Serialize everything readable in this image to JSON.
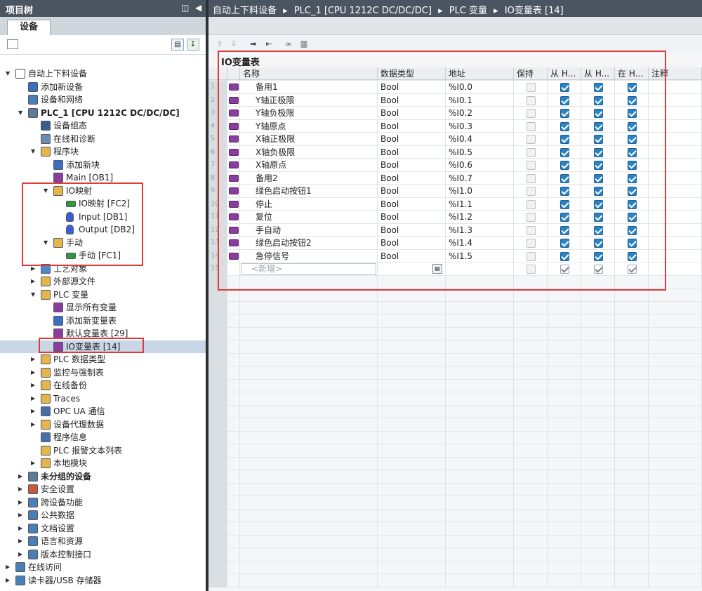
{
  "left": {
    "title": "项目树",
    "tab": "设备",
    "controls": [
      "◫",
      "◀"
    ]
  },
  "tree": [
    {
      "label": "自动上下料设备",
      "indent": 0,
      "arrow": "▼",
      "icon": "doc-icon",
      "color": "#ffffff"
    },
    {
      "label": "添加新设备",
      "indent": 1,
      "arrow": "",
      "icon": "add-device-icon",
      "color": "#3a6fc4"
    },
    {
      "label": "设备和网络",
      "indent": 1,
      "arrow": "",
      "icon": "network-icon",
      "color": "#4a7fb5"
    },
    {
      "label": "PLC_1 [CPU 1212C DC/DC/DC]",
      "indent": 1,
      "arrow": "▼",
      "icon": "plc-icon",
      "color": "#5f7c96",
      "bold": true
    },
    {
      "label": "设备组态",
      "indent": 2,
      "arrow": "",
      "icon": "config-icon",
      "color": "#3b5f8a"
    },
    {
      "label": "在线和诊断",
      "indent": 2,
      "arrow": "",
      "icon": "diagnostics-icon",
      "color": "#6c8bb0"
    },
    {
      "label": "程序块",
      "indent": 2,
      "arrow": "▼",
      "icon": "folder-icon",
      "color": "#e3b54a"
    },
    {
      "label": "添加新块",
      "indent": 3,
      "arrow": "",
      "icon": "add-block-icon",
      "color": "#3a6fc4"
    },
    {
      "label": "Main [OB1]",
      "indent": 3,
      "arrow": "",
      "icon": "ob-icon",
      "color": "#8a3d9e"
    },
    {
      "label": "IO映射",
      "indent": 3,
      "arrow": "▼",
      "icon": "folder-icon",
      "color": "#e3b54a"
    },
    {
      "label": "IO映射 [FC2]",
      "indent": 4,
      "arrow": "",
      "icon": "fc-icon",
      "color": "#2e9a3a"
    },
    {
      "label": "Input [DB1]",
      "indent": 4,
      "arrow": "",
      "icon": "db-icon",
      "color": "#3a5fd0"
    },
    {
      "label": "Output [DB2]",
      "indent": 4,
      "arrow": "",
      "icon": "db-icon",
      "color": "#3a5fd0"
    },
    {
      "label": "手动",
      "indent": 3,
      "arrow": "▼",
      "icon": "folder-icon",
      "color": "#e3b54a"
    },
    {
      "label": "手动 [FC1]",
      "indent": 4,
      "arrow": "",
      "icon": "fc-icon",
      "color": "#2e9a3a"
    },
    {
      "label": "工艺对象",
      "indent": 2,
      "arrow": "▶",
      "icon": "tech-object-icon",
      "color": "#4f87c7"
    },
    {
      "label": "外部源文件",
      "indent": 2,
      "arrow": "▶",
      "icon": "folder-icon",
      "color": "#e3b54a"
    },
    {
      "label": "PLC 变量",
      "indent": 2,
      "arrow": "▼",
      "icon": "tag-folder-icon",
      "color": "#e3b54a"
    },
    {
      "label": "显示所有变量",
      "indent": 3,
      "arrow": "",
      "icon": "tag-table-icon",
      "color": "#8a3d9e"
    },
    {
      "label": "添加新变量表",
      "indent": 3,
      "arrow": "",
      "icon": "add-tag-table-icon",
      "color": "#3a6fc4"
    },
    {
      "label": "默认变量表 [29]",
      "indent": 3,
      "arrow": "",
      "icon": "tag-table-icon",
      "color": "#8a3d9e"
    },
    {
      "label": "IO变量表 [14]",
      "indent": 3,
      "arrow": "",
      "icon": "tag-table-icon",
      "color": "#8a3d9e",
      "selected": true
    },
    {
      "label": "PLC 数据类型",
      "indent": 2,
      "arrow": "▶",
      "icon": "folder-icon",
      "color": "#e3b54a"
    },
    {
      "label": "监控与强制表",
      "indent": 2,
      "arrow": "▶",
      "icon": "folder-icon",
      "color": "#e3b54a"
    },
    {
      "label": "在线备份",
      "indent": 2,
      "arrow": "▶",
      "icon": "folder-icon",
      "color": "#e3b54a"
    },
    {
      "label": "Traces",
      "indent": 2,
      "arrow": "▶",
      "icon": "traces-icon",
      "color": "#e3b54a"
    },
    {
      "label": "OPC UA 通信",
      "indent": 2,
      "arrow": "▶",
      "icon": "opcua-icon",
      "color": "#4a6fa5"
    },
    {
      "label": "设备代理数据",
      "indent": 2,
      "arrow": "▶",
      "icon": "proxy-data-icon",
      "color": "#e3b54a"
    },
    {
      "label": "程序信息",
      "indent": 2,
      "arrow": "",
      "icon": "info-icon",
      "color": "#4a6fa5"
    },
    {
      "label": "PLC 报警文本列表",
      "indent": 2,
      "arrow": "",
      "icon": "alarm-list-icon",
      "color": "#e3b54a"
    },
    {
      "label": "本地模块",
      "indent": 2,
      "arrow": "▶",
      "icon": "folder-icon",
      "color": "#e3b54a"
    },
    {
      "label": "未分组的设备",
      "indent": 1,
      "arrow": "▶",
      "icon": "ungrouped-icon",
      "color": "#5f7c96",
      "bold": true
    },
    {
      "label": "安全设置",
      "indent": 1,
      "arrow": "▶",
      "icon": "security-icon",
      "color": "#c85a3a"
    },
    {
      "label": "跨设备功能",
      "indent": 1,
      "arrow": "▶",
      "icon": "cross-device-icon",
      "color": "#4a7fb5"
    },
    {
      "label": "公共数据",
      "indent": 1,
      "arrow": "▶",
      "icon": "common-data-icon",
      "color": "#4a7fb5"
    },
    {
      "label": "文档设置",
      "indent": 1,
      "arrow": "▶",
      "icon": "doc-settings-icon",
      "color": "#4a7fb5"
    },
    {
      "label": "语言和资源",
      "indent": 1,
      "arrow": "▶",
      "icon": "language-icon",
      "color": "#4a7fb5"
    },
    {
      "label": "版本控制接口",
      "indent": 1,
      "arrow": "▶",
      "icon": "version-control-icon",
      "color": "#4a7fb5"
    },
    {
      "label": "在线访问",
      "indent": 0,
      "arrow": "▶",
      "icon": "online-access-icon",
      "color": "#4a7fb5"
    },
    {
      "label": "读卡器/USB 存储器",
      "indent": 0,
      "arrow": "▶",
      "icon": "usb-icon",
      "color": "#4a7fb5"
    }
  ],
  "breadcrumb": {
    "parts": [
      "自动上下料设备",
      "PLC_1 [CPU 1212C DC/DC/DC]",
      "PLC 变量",
      "IO变量表 [14]"
    ],
    "sep": "▸"
  },
  "table": {
    "title": "IO变量表",
    "headers": [
      "名称",
      "数据类型",
      "地址",
      "保持",
      "从 H...",
      "从 H...",
      "在 H...",
      "注释"
    ],
    "rows": [
      {
        "n": "1",
        "name": "备用1",
        "type": "Bool",
        "addr": "%I0.0"
      },
      {
        "n": "2",
        "name": "Y轴正极限",
        "type": "Bool",
        "addr": "%I0.1"
      },
      {
        "n": "3",
        "name": "Y轴负极限",
        "type": "Bool",
        "addr": "%I0.2"
      },
      {
        "n": "4",
        "name": "Y轴原点",
        "type": "Bool",
        "addr": "%I0.3"
      },
      {
        "n": "5",
        "name": "X轴正极限",
        "type": "Bool",
        "addr": "%I0.4"
      },
      {
        "n": "6",
        "name": "X轴负极限",
        "type": "Bool",
        "addr": "%I0.5"
      },
      {
        "n": "7",
        "name": "X轴原点",
        "type": "Bool",
        "addr": "%I0.6"
      },
      {
        "n": "8",
        "name": "备用2",
        "type": "Bool",
        "addr": "%I0.7"
      },
      {
        "n": "9",
        "name": "绿色启动按钮1",
        "type": "Bool",
        "addr": "%I1.0"
      },
      {
        "n": "10",
        "name": "停止",
        "type": "Bool",
        "addr": "%I1.1"
      },
      {
        "n": "11",
        "name": "复位",
        "type": "Bool",
        "addr": "%I1.2"
      },
      {
        "n": "12",
        "name": "手自动",
        "type": "Bool",
        "addr": "%I1.3"
      },
      {
        "n": "13",
        "name": "绿色启动按钮2",
        "type": "Bool",
        "addr": "%I1.4"
      },
      {
        "n": "14",
        "name": "急停信号",
        "type": "Bool",
        "addr": "%I1.5"
      }
    ],
    "new_row": {
      "n": "15",
      "placeholder": "<新增>"
    }
  },
  "colors": {
    "accent": "#2a83c4",
    "highlight": "#e03a3a",
    "header_bar": "#4b5561"
  }
}
